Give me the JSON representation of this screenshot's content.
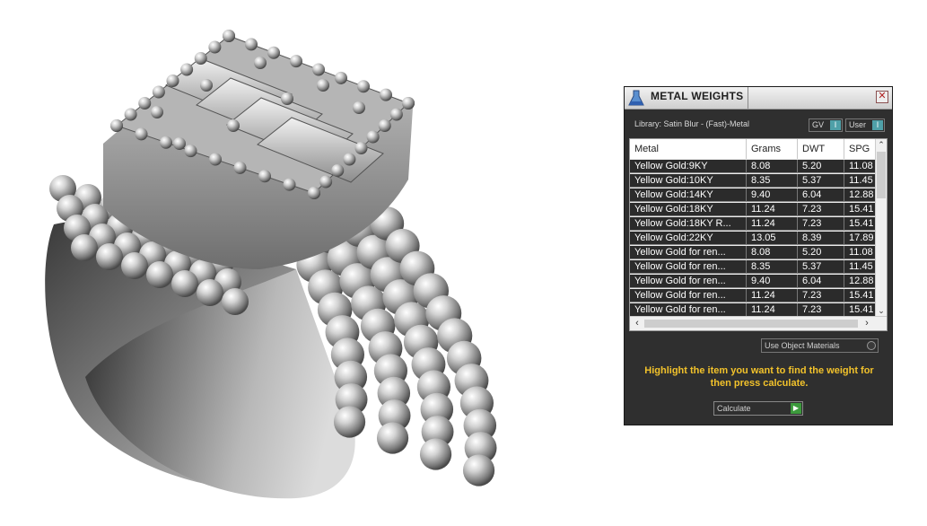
{
  "panel": {
    "title": "METAL WEIGHTS",
    "close_label": "✕",
    "library_label": "Library: Satin Blur - (Fast)-Metal",
    "gv_toggle": {
      "label": "GV",
      "knob": "I"
    },
    "user_toggle": {
      "label": "User",
      "knob": "I"
    },
    "table": {
      "headers": [
        "Metal",
        "Grams",
        "DWT",
        "SPG"
      ],
      "rows": [
        [
          "Yellow Gold:9KY",
          "8.08",
          "5.20",
          "11.08"
        ],
        [
          "Yellow Gold:10KY",
          "8.35",
          "5.37",
          "11.45"
        ],
        [
          "Yellow Gold:14KY",
          "9.40",
          "6.04",
          "12.88"
        ],
        [
          "Yellow Gold:18KY",
          "11.24",
          "7.23",
          "15.41"
        ],
        [
          "Yellow Gold:18KY R...",
          "11.24",
          "7.23",
          "15.41"
        ],
        [
          "Yellow Gold:22KY",
          "13.05",
          "8.39",
          "17.89"
        ],
        [
          "Yellow Gold for ren...",
          "8.08",
          "5.20",
          "11.08"
        ],
        [
          "Yellow Gold for ren...",
          "8.35",
          "5.37",
          "11.45"
        ],
        [
          "Yellow Gold for ren...",
          "9.40",
          "6.04",
          "12.88"
        ],
        [
          "Yellow Gold for ren...",
          "11.24",
          "7.23",
          "15.41"
        ],
        [
          "Yellow Gold for ren...",
          "11.24",
          "7.23",
          "15.41"
        ]
      ]
    },
    "use_object_materials": "Use Object Materials",
    "hint": "Highlight the item you want to find the weight for then press calculate.",
    "calculate_label": "Calculate"
  },
  "colors": {
    "panel_bg": "#2f2f2f",
    "hint_text": "#f2c22b",
    "toggle_accent": "#4fa0a8",
    "go_button": "#3c9a3c"
  }
}
